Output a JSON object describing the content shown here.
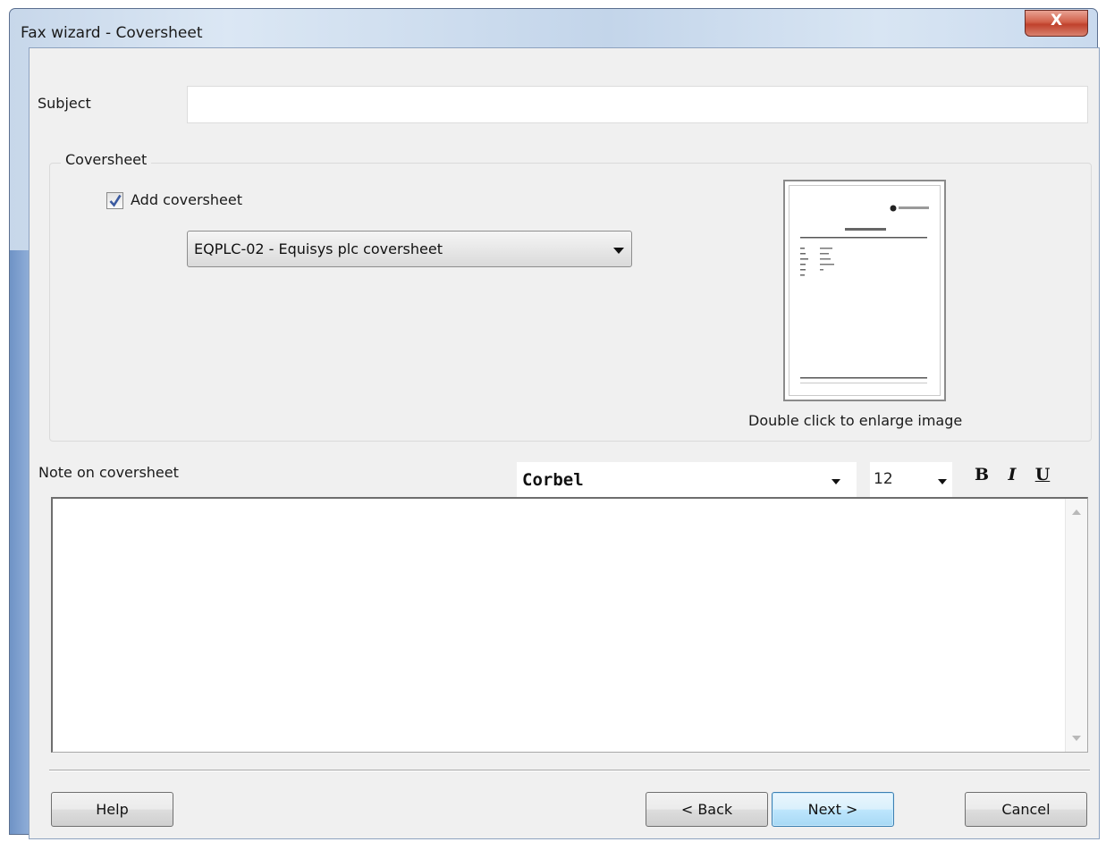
{
  "window": {
    "title": "Fax wizard - Coversheet",
    "close_label": "X"
  },
  "subject": {
    "label": "Subject",
    "value": ""
  },
  "coversheet": {
    "group_label": "Coversheet",
    "add_label": "Add coversheet",
    "add_checked": true,
    "selected": "EQPLC-02 - Equisys plc coversheet",
    "preview_hint": "Double click to enlarge image"
  },
  "note": {
    "label": "Note on coversheet",
    "font": "Corbel",
    "size": "12",
    "value": "",
    "format": {
      "bold": "B",
      "italic": "I",
      "underline": "U"
    }
  },
  "buttons": {
    "help": "Help",
    "back": "< Back",
    "next": "Next >",
    "cancel": "Cancel"
  }
}
